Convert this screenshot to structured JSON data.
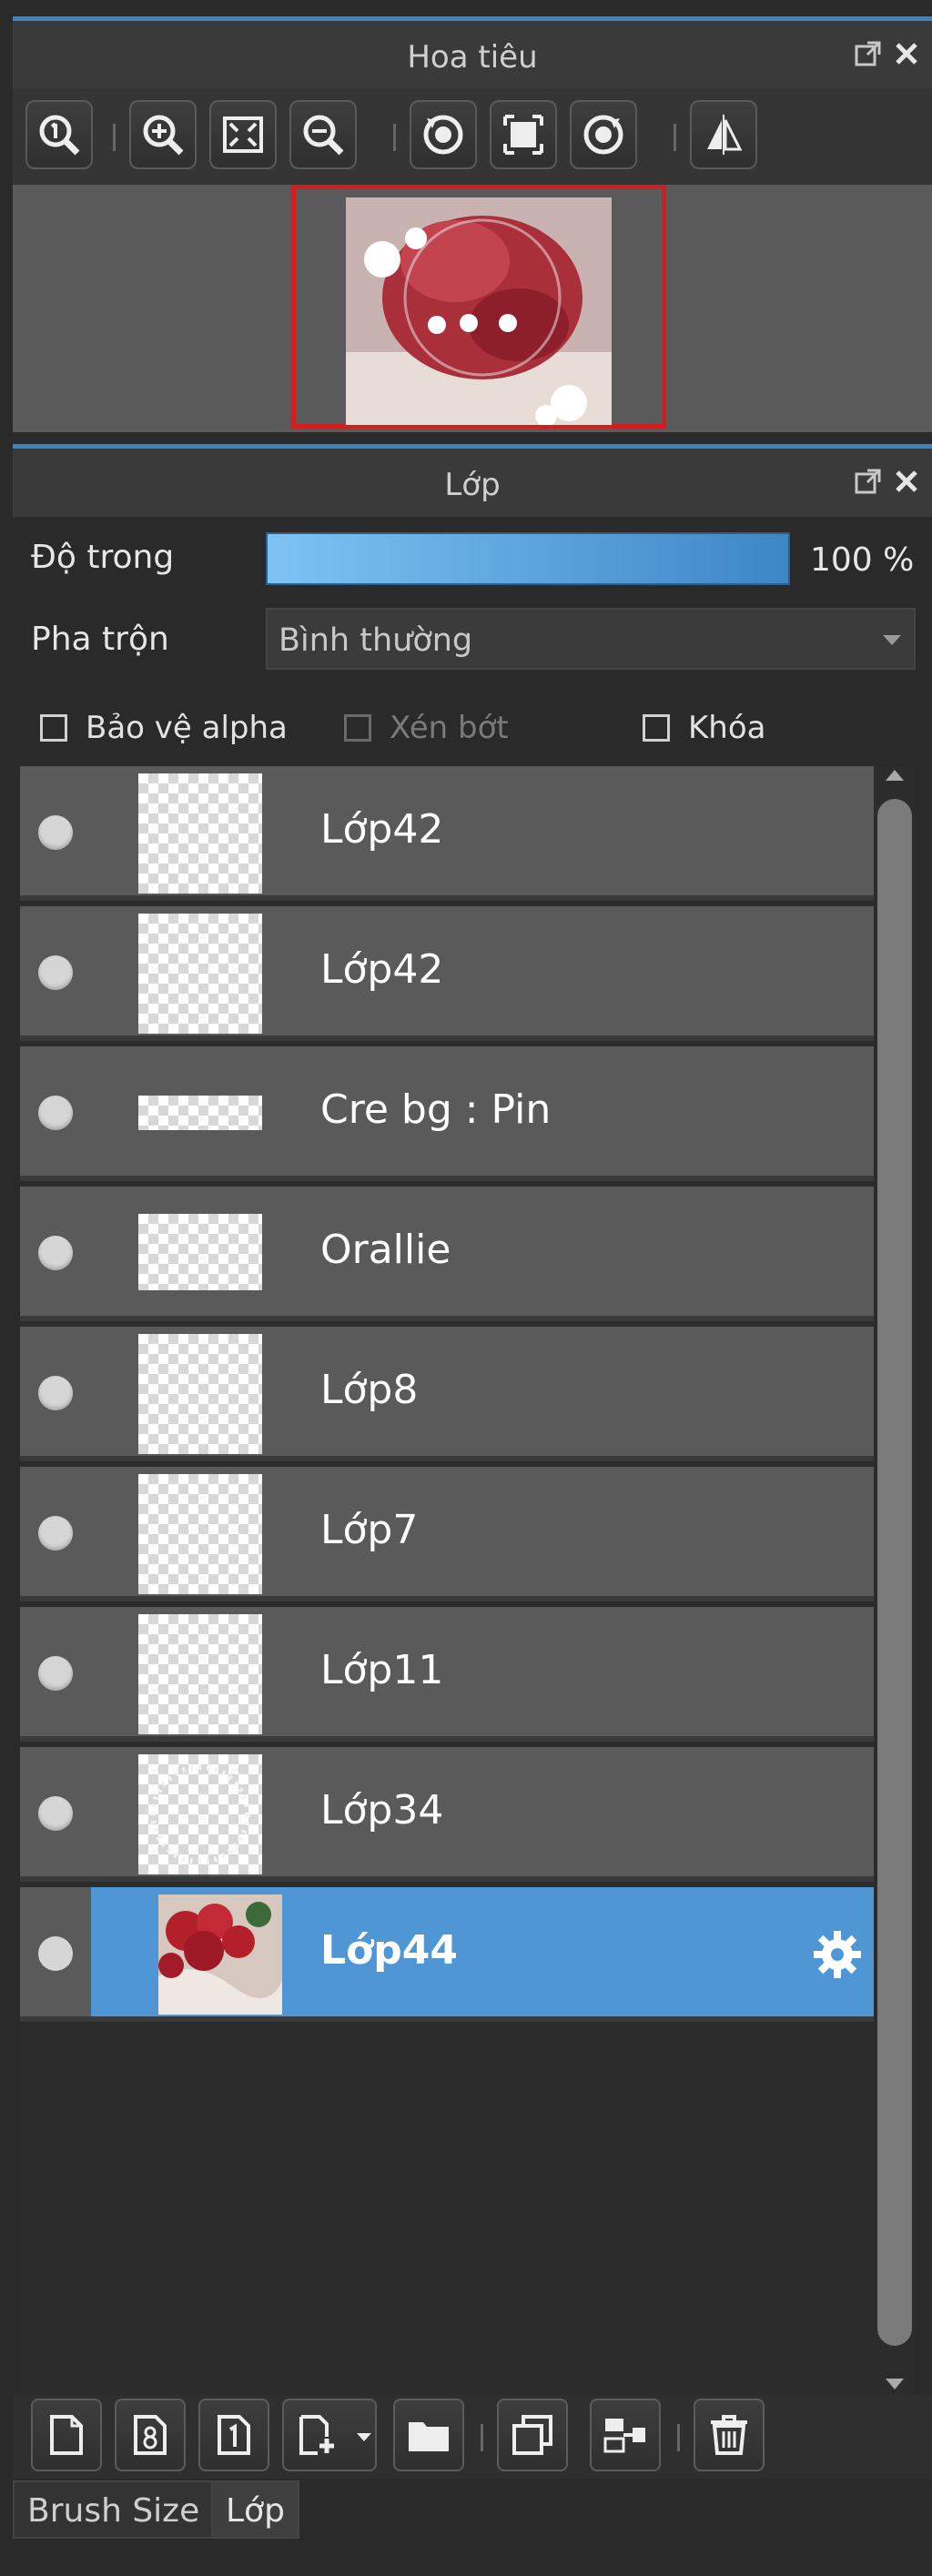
{
  "navigator": {
    "title": "Hoa tiêu",
    "toolbar": [
      {
        "icon": "zoom-actual-icon"
      },
      {
        "icon": "zoom-in-icon"
      },
      {
        "icon": "fit-screen-icon"
      },
      {
        "icon": "zoom-out-icon"
      },
      {
        "icon": "rotate-left-icon"
      },
      {
        "icon": "reset-view-icon"
      },
      {
        "icon": "rotate-right-icon"
      },
      {
        "icon": "flip-horizontal-icon"
      }
    ]
  },
  "layer_panel": {
    "title": "Lớp",
    "opacity_label": "Độ trong",
    "opacity_value": "100 %",
    "opacity_level": 1.0,
    "blend_label": "Pha trộn",
    "blend_value": "Bình thường",
    "checkboxes": {
      "protect_alpha": "Bảo vệ alpha",
      "clipping": "Xén bớt",
      "lock": "Khóa"
    },
    "layers": [
      {
        "name": "Lớp42",
        "visible": true
      },
      {
        "name": "Lớp42",
        "visible": true
      },
      {
        "name": "Cre bg : Pin",
        "visible": true
      },
      {
        "name": "Orallie",
        "visible": true
      },
      {
        "name": "Lớp8",
        "visible": true
      },
      {
        "name": "Lớp7",
        "visible": true
      },
      {
        "name": "Lớp11",
        "visible": true
      },
      {
        "name": "Lớp34",
        "visible": true
      },
      {
        "name": "Lớp44",
        "visible": true,
        "selected": true
      }
    ],
    "selected_color": "#4e97d4",
    "bottom_toolbar": [
      {
        "icon": "new-layer-icon"
      },
      {
        "icon": "new-8bit-layer-icon"
      },
      {
        "icon": "new-1bit-layer-icon"
      },
      {
        "icon": "add-layer-menu-icon"
      },
      {
        "icon": "folder-icon"
      },
      {
        "icon": "duplicate-layer-icon"
      },
      {
        "icon": "merge-down-icon"
      },
      {
        "icon": "trash-icon"
      }
    ]
  },
  "tabs": [
    {
      "label": "Brush Size",
      "active": false
    },
    {
      "label": "Lớp",
      "active": true
    }
  ]
}
